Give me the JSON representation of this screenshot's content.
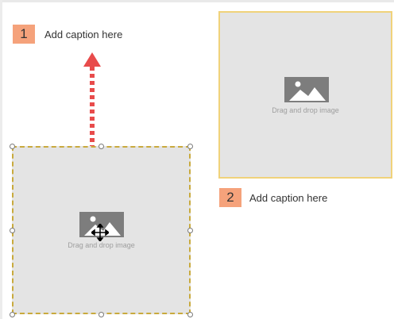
{
  "slide": {
    "item1": {
      "number": "1",
      "caption": "Add caption here",
      "drop_text": "Drag and drop image"
    },
    "item2": {
      "number": "2",
      "caption": "Add caption here",
      "drop_text": "Drag and drop image"
    }
  },
  "icons": {
    "image_placeholder": "image-icon",
    "arrow": "double-headed-arrow-icon",
    "cursor": "move-cursor-icon"
  },
  "colors": {
    "badge": "#f5a27b",
    "frame_border": "#f0d27a",
    "frame_fill": "#e4e4e4",
    "arrow": "#e84b4b"
  }
}
